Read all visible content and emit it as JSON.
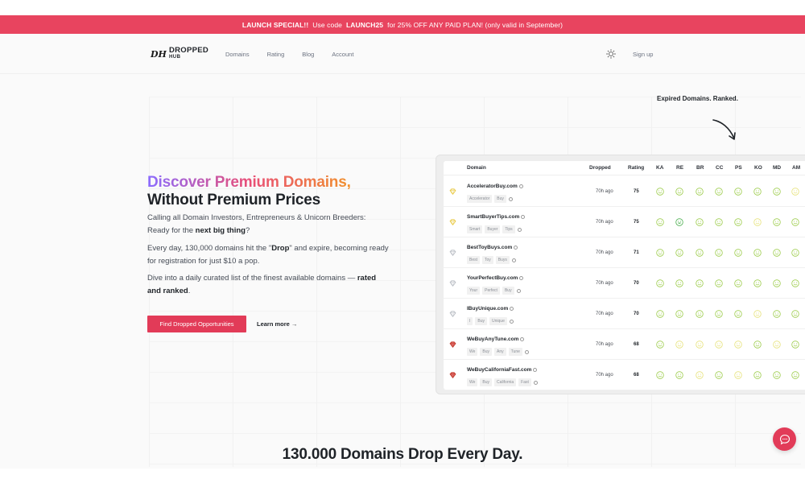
{
  "banner": {
    "prefix": "LAUNCH SPECIAL!!",
    "text1": "Use code",
    "code": "LAUNCH25",
    "text2": "for 25% OFF ANY PAID PLAN! (only valid in September)"
  },
  "nav": {
    "logo_mark": "DH",
    "logo_line1": "DROPPED",
    "logo_line2": "HUB",
    "links": [
      "Domains",
      "Rating",
      "Blog",
      "Account"
    ],
    "signup": "Sign up"
  },
  "hero": {
    "headline_part1": "Discover Premium Domains,",
    "headline_part2": "Without Premium Prices",
    "p1_a": "Calling all Domain Investors, Entrepreneurs & Unicorn Breeders: Ready for the ",
    "p1_b": "next big thing",
    "p1_c": "?",
    "p2_a": "Every day, 130,000 domains hit the \"",
    "p2_b": "Drop",
    "p2_c": "\" and expire, becoming ready for registration for just $10 a pop.",
    "p3_a": "Dive into a daily curated list of the finest available domains — ",
    "p3_b": "rated and ranked",
    "p3_c": ".",
    "cta": "Find Dropped Opportunities",
    "learn_more": "Learn more →",
    "tagline": "Expired Domains. Ranked."
  },
  "table": {
    "headers": {
      "domain": "Domain",
      "dropped": "Dropped",
      "rating": "Rating",
      "cols": [
        "KA",
        "RE",
        "BR",
        "CC",
        "PS",
        "KO",
        "MD",
        "AM"
      ]
    },
    "rows": [
      {
        "name": "AcceleratorBuy.com",
        "tags": [
          "Accelerator",
          "Buy"
        ],
        "dropped": "70h ago",
        "rating": "75",
        "gem": "gold",
        "faces": [
          "green",
          "green",
          "green",
          "green",
          "green",
          "green",
          "green",
          "light"
        ]
      },
      {
        "name": "SmartBuyerTips.com",
        "tags": [
          "Smart",
          "Buyer",
          "Tips"
        ],
        "dropped": "70h ago",
        "rating": "75",
        "gem": "gold",
        "faces": [
          "green",
          "happy",
          "green",
          "green",
          "green",
          "light",
          "green",
          "green"
        ]
      },
      {
        "name": "BestToyBuys.com",
        "tags": [
          "Best",
          "Toy",
          "Buys"
        ],
        "dropped": "70h ago",
        "rating": "71",
        "gem": "silver",
        "faces": [
          "green",
          "green",
          "green",
          "green",
          "green",
          "green",
          "green",
          "green"
        ]
      },
      {
        "name": "YourPerfectBuy.com",
        "tags": [
          "Your",
          "Perfect",
          "Buy"
        ],
        "dropped": "70h ago",
        "rating": "70",
        "gem": "silver",
        "faces": [
          "green",
          "green",
          "green",
          "green",
          "green",
          "green",
          "green",
          "green"
        ]
      },
      {
        "name": "IBuyUnique.com",
        "tags": [
          "I",
          "Buy",
          "Unique"
        ],
        "dropped": "70h ago",
        "rating": "70",
        "gem": "silver",
        "faces": [
          "green",
          "green",
          "green",
          "green",
          "green",
          "light",
          "green",
          "green"
        ]
      },
      {
        "name": "WeBuyAnyTune.com",
        "tags": [
          "We",
          "Buy",
          "Any",
          "Tune"
        ],
        "dropped": "70h ago",
        "rating": "68",
        "gem": "red",
        "faces": [
          "green",
          "light",
          "light",
          "light",
          "light",
          "green",
          "light",
          "green"
        ]
      },
      {
        "name": "WeBuyCaliforniaFast.com",
        "tags": [
          "We",
          "Buy",
          "California",
          "Fast"
        ],
        "dropped": "70h ago",
        "rating": "68",
        "gem": "red",
        "faces": [
          "green",
          "green",
          "light",
          "green",
          "light",
          "green",
          "green",
          "green"
        ]
      }
    ]
  },
  "stats": {
    "title": "130.000 Domains Drop Every Day."
  },
  "colors": {
    "accent": "#e23b58",
    "banner": "#e8445f",
    "face_green": "#9ccc4a",
    "face_light": "#e6e27a",
    "face_happy": "#4caf50"
  }
}
